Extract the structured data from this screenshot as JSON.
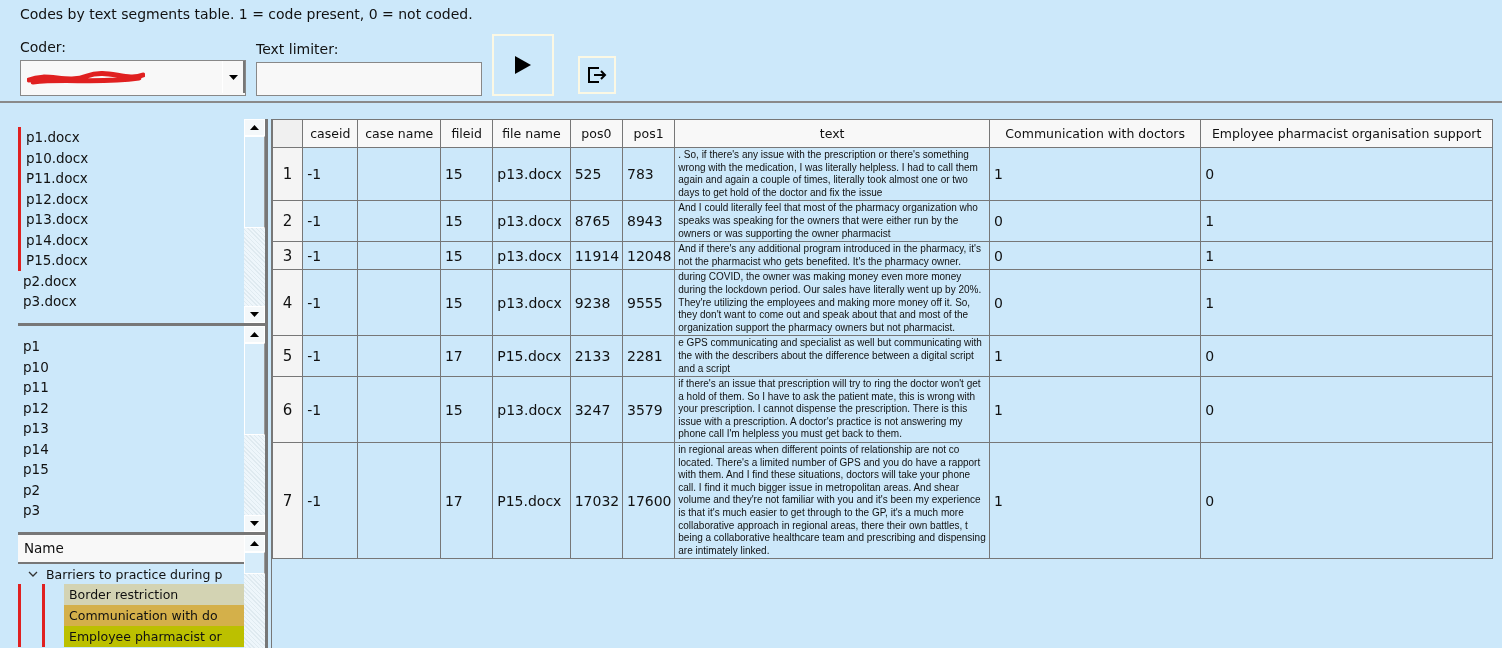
{
  "caption": "Codes by text segments table. 1 = code present, 0 = not coded.",
  "coder": {
    "label": "Coder:",
    "redacted": true
  },
  "text_limiter": {
    "label": "Text limiter:"
  },
  "files": [
    {
      "name": "p1.docx",
      "marked": true
    },
    {
      "name": "p10.docx",
      "marked": true
    },
    {
      "name": "P11.docx",
      "marked": true
    },
    {
      "name": "p12.docx",
      "marked": true
    },
    {
      "name": "p13.docx",
      "marked": true
    },
    {
      "name": "p14.docx",
      "marked": true
    },
    {
      "name": "P15.docx",
      "marked": true
    },
    {
      "name": "p2.docx",
      "marked": false
    },
    {
      "name": "p3.docx",
      "marked": false
    }
  ],
  "cases": [
    "p1",
    "p10",
    "p11",
    "p12",
    "p13",
    "p14",
    "p15",
    "p2",
    "p3"
  ],
  "codes_tree": {
    "column": "Name",
    "items": [
      {
        "name": "Barriers to practice during p",
        "expanded": true,
        "children": [
          {
            "name": "Border restriction",
            "color": "#d3d3b3",
            "marked": true
          },
          {
            "name": "Communication with do",
            "color": "#d4b04a",
            "marked": true
          },
          {
            "name": "Employee pharmacist or",
            "color": "#bcc000",
            "marked": true
          }
        ]
      }
    ]
  },
  "table": {
    "columns": [
      "caseid",
      "case name",
      "fileid",
      "file name",
      "pos0",
      "pos1",
      "text",
      "Communication with doctors",
      "Employee pharmacist organisation support"
    ],
    "rows": [
      {
        "number": "1",
        "cells": [
          "-1",
          "",
          "15",
          "p13.docx",
          "525",
          "783",
          ". So, if there's any issue with the prescription or there's something wrong with the medication, I was literally helpless. I had to call them again and again a couple of times, literally took almost one or two days to get hold of the doctor and fix the issue",
          "1",
          "0"
        ]
      },
      {
        "number": "2",
        "cells": [
          "-1",
          "",
          "15",
          "p13.docx",
          "8765",
          "8943",
          "And I could literally feel that most of the pharmacy organization who speaks was speaking for the owners that were either run by the owners or was supporting the owner pharmacist",
          "0",
          "1"
        ]
      },
      {
        "number": "3",
        "cells": [
          "-1",
          "",
          "15",
          "p13.docx",
          "11914",
          "12048",
          "And if there's any additional program introduced in the pharmacy, it's not the pharmacist who gets benefited. It's the pharmacy owner.",
          "0",
          "1"
        ]
      },
      {
        "number": "4",
        "cells": [
          "-1",
          "",
          "15",
          "p13.docx",
          "9238",
          "9555",
          "during COVID, the owner was making money even more money during the lockdown period. Our sales have literally went up by 20%. They're utilizing the employees and making more money off it. So, they don't want to come out and speak about that and most of the organization support the pharmacy owners but not pharmacist.",
          "0",
          "1"
        ]
      },
      {
        "number": "5",
        "cells": [
          "-1",
          "",
          "17",
          "P15.docx",
          "2133",
          "2281",
          "e GPS communicating and specialist as well but communicating with the with the describers about the difference between a digital script and a script",
          "1",
          "0"
        ]
      },
      {
        "number": "6",
        "cells": [
          "-1",
          "",
          "15",
          "p13.docx",
          "3247",
          "3579",
          "if there's an issue that prescription will try to ring the doctor won't get a hold of them. So I have to ask the patient mate, this is wrong with your prescription. I cannot dispense the prescription. There is this issue with a prescription. A doctor's practice is not answering my phone call I'm helpless you must get back to them.",
          "1",
          "0"
        ]
      },
      {
        "number": "7",
        "cells": [
          "-1",
          "",
          "17",
          "P15.docx",
          "17032",
          "17600",
          "in regional areas when different points of relationship are not co located. There's a limited number of GPS and you do have a rapport with them. And I find these situations, doctors will take your phone call. I find it much bigger issue in metropolitan areas. And shear volume and they're not familiar with you and it's been my experience is that it's much easier to get through to the GP, it's a much more collaborative approach in regional areas, there their own battles, t being a collaborative healthcare team and prescribing and dispensing are intimately linked.",
          "1",
          "0"
        ]
      }
    ]
  }
}
